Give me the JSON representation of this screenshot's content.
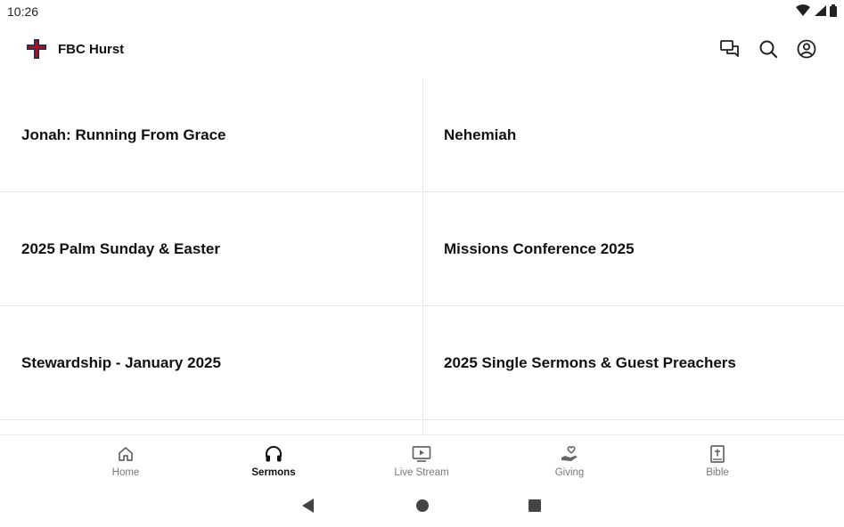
{
  "status_bar": {
    "time": "10:26"
  },
  "app_bar": {
    "title": "FBC Hurst",
    "actions": [
      "messages-icon",
      "search-icon",
      "account-icon"
    ]
  },
  "sermon_series": [
    {
      "title": "Jonah: Running From Grace"
    },
    {
      "title": "Nehemiah"
    },
    {
      "title": "2025 Palm Sunday & Easter"
    },
    {
      "title": "Missions Conference 2025"
    },
    {
      "title": "Stewardship - January 2025"
    },
    {
      "title": "2025 Single Sermons & Guest Preachers"
    }
  ],
  "bottom_nav": {
    "active": "Sermons",
    "items": [
      {
        "label": "Home",
        "icon": "home-icon"
      },
      {
        "label": "Sermons",
        "icon": "headphones-icon"
      },
      {
        "label": "Live Stream",
        "icon": "live-stream-icon"
      },
      {
        "label": "Giving",
        "icon": "giving-icon"
      },
      {
        "label": "Bible",
        "icon": "bible-icon"
      }
    ]
  },
  "colors": {
    "brand_red": "#a3122a",
    "brand_navy": "#1f2f4a",
    "active": "#111111",
    "inactive": "#777777"
  }
}
